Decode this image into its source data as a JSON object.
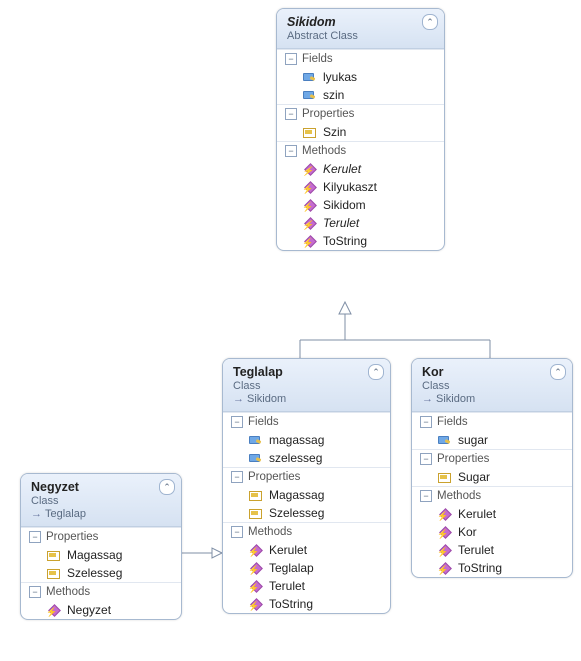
{
  "classes": {
    "sikidom": {
      "title": "Sikidom",
      "subtitle": "Abstract Class",
      "sections": {
        "fields": {
          "label": "Fields",
          "items": [
            "lyukas",
            "szin"
          ]
        },
        "properties": {
          "label": "Properties",
          "items": [
            "Szin"
          ]
        },
        "methods": {
          "label": "Methods",
          "items": [
            {
              "name": "Kerulet",
              "abstract": true
            },
            {
              "name": "Kilyukaszt",
              "abstract": false
            },
            {
              "name": "Sikidom",
              "abstract": false
            },
            {
              "name": "Terulet",
              "abstract": true
            },
            {
              "name": "ToString",
              "abstract": false
            }
          ]
        }
      }
    },
    "teglalap": {
      "title": "Teglalap",
      "subtitle": "Class",
      "inherits": "Sikidom",
      "sections": {
        "fields": {
          "label": "Fields",
          "items": [
            "magassag",
            "szelesseg"
          ]
        },
        "properties": {
          "label": "Properties",
          "items": [
            "Magassag",
            "Szelesseg"
          ]
        },
        "methods": {
          "label": "Methods",
          "items": [
            "Kerulet",
            "Teglalap",
            "Terulet",
            "ToString"
          ]
        }
      }
    },
    "kor": {
      "title": "Kor",
      "subtitle": "Class",
      "inherits": "Sikidom",
      "sections": {
        "fields": {
          "label": "Fields",
          "items": [
            "sugar"
          ]
        },
        "properties": {
          "label": "Properties",
          "items": [
            "Sugar"
          ]
        },
        "methods": {
          "label": "Methods",
          "items": [
            "Kerulet",
            "Kor",
            "Terulet",
            "ToString"
          ]
        }
      }
    },
    "negyzet": {
      "title": "Negyzet",
      "subtitle": "Class",
      "inherits": "Teglalap",
      "sections": {
        "properties": {
          "label": "Properties",
          "items": [
            "Magassag",
            "Szelesseg"
          ]
        },
        "methods": {
          "label": "Methods",
          "items": [
            "Negyzet"
          ]
        }
      }
    }
  },
  "relations": [
    {
      "from": "teglalap",
      "to": "sikidom",
      "kind": "inherit"
    },
    {
      "from": "kor",
      "to": "sikidom",
      "kind": "inherit"
    },
    {
      "from": "negyzet",
      "to": "teglalap",
      "kind": "inherit"
    }
  ]
}
